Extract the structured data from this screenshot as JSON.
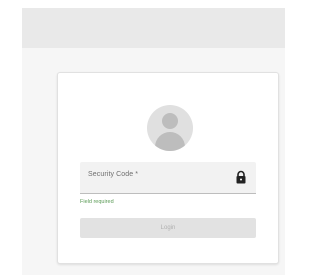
{
  "login": {
    "field_label": "Security Code *",
    "helper_text": "Field required",
    "button_label": "Login",
    "icons": {
      "avatar": "person-icon",
      "field": "lock-icon"
    }
  },
  "colors": {
    "helper_text": "#5a9a55",
    "avatar": "#e0e0e0",
    "button_disabled": "#e2e2e2"
  }
}
